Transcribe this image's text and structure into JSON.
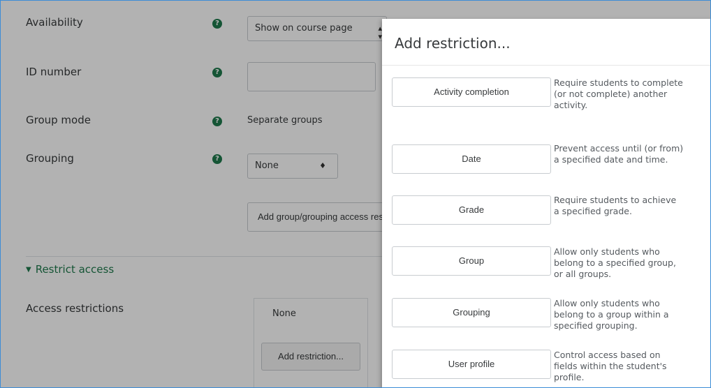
{
  "form": {
    "availability": {
      "label": "Availability",
      "value": "Show on course page"
    },
    "id_number": {
      "label": "ID number",
      "value": ""
    },
    "group_mode": {
      "label": "Group mode",
      "value": "Separate groups"
    },
    "grouping": {
      "label": "Grouping",
      "value": "None"
    },
    "add_group_button": "Add group/grouping access restriction",
    "restrict_section": {
      "label": "Restrict access"
    },
    "access_restrictions": {
      "label": "Access restrictions",
      "current": "None",
      "add_button": "Add restriction..."
    }
  },
  "modal": {
    "title": "Add restriction...",
    "options": [
      {
        "label": "Activity completion",
        "description": "Require students to complete (or not complete) another activity."
      },
      {
        "label": "Date",
        "description": "Prevent access until (or from) a specified date and time."
      },
      {
        "label": "Grade",
        "description": "Require students to achieve a specified grade."
      },
      {
        "label": "Group",
        "description": "Allow only students who belong to a specified group, or all groups."
      },
      {
        "label": "Grouping",
        "description": "Allow only students who belong to a group within a specified grouping."
      },
      {
        "label": "User profile",
        "description": "Control access based on fields within the student's profile."
      }
    ]
  },
  "colors": {
    "accent_green": "#1f7a4d",
    "frame_blue": "#3c8dd6"
  },
  "icons": {
    "help": "question-circle-icon",
    "select_arrow": "updown-caret-icon",
    "section_caret": "caret-down-icon"
  }
}
